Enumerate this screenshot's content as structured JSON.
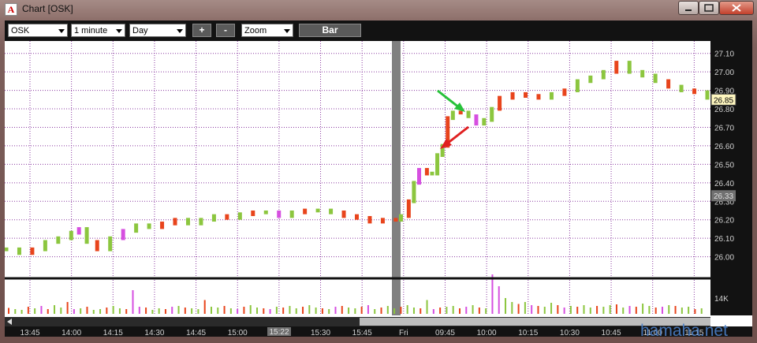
{
  "window": {
    "app_icon_letter": "A",
    "title": "Chart [OSK]"
  },
  "toolbar": {
    "symbol": "OSK",
    "interval": "1 minute",
    "range": "Day",
    "zoom_in_label": "+",
    "zoom_out_label": "-",
    "zoom": "Zoom",
    "chart_style": "Bar"
  },
  "chart_data": {
    "type": "candlestick",
    "symbol": "OSK",
    "y_ticks": [
      "27.10",
      "27.00",
      "26.90",
      "26.80",
      "26.70",
      "26.60",
      "26.50",
      "26.40",
      "26.30",
      "26.20",
      "26.10",
      "26.00"
    ],
    "ylim": [
      25.93,
      27.15
    ],
    "current_price_label": "26.85",
    "cursor_price_label": "26.33",
    "volume_label": "14K",
    "x_ticks": [
      "13:45",
      "14:00",
      "14:15",
      "14:30",
      "14:45",
      "15:00",
      "15:15",
      "15:30",
      "15:45",
      "Fri",
      "09:45",
      "10:00",
      "10:15",
      "10:30",
      "10:45",
      "11:00",
      "11:15"
    ],
    "cursor_time_label": "15:22",
    "price_series": [
      [
        0,
        26.04
      ],
      [
        5,
        26.02
      ],
      [
        10,
        26.04
      ],
      [
        15,
        26.08
      ],
      [
        20,
        26.1
      ],
      [
        25,
        26.13
      ],
      [
        28,
        26.15
      ],
      [
        31,
        26.08
      ],
      [
        35,
        26.04
      ],
      [
        40,
        26.1
      ],
      [
        45,
        26.14
      ],
      [
        50,
        26.17
      ],
      [
        55,
        26.16
      ],
      [
        60,
        26.18
      ],
      [
        65,
        26.2
      ],
      [
        70,
        26.18
      ],
      [
        75,
        26.2
      ],
      [
        80,
        26.22
      ],
      [
        85,
        26.21
      ],
      [
        90,
        26.23
      ],
      [
        95,
        26.24
      ],
      [
        100,
        26.24
      ],
      [
        105,
        26.22
      ],
      [
        110,
        26.24
      ],
      [
        115,
        26.25
      ],
      [
        120,
        26.25
      ],
      [
        125,
        26.24
      ],
      [
        130,
        26.22
      ],
      [
        135,
        26.21
      ],
      [
        140,
        26.19
      ],
      [
        145,
        26.2
      ],
      [
        150,
        26.2
      ],
      [
        152,
        26.22
      ],
      [
        155,
        26.3
      ],
      [
        157,
        26.4
      ],
      [
        159,
        26.47
      ],
      [
        162,
        26.45
      ],
      [
        164,
        26.45
      ],
      [
        166,
        26.55
      ],
      [
        168,
        26.6
      ],
      [
        170,
        26.75
      ],
      [
        172,
        26.78
      ],
      [
        175,
        26.78
      ],
      [
        178,
        26.76
      ],
      [
        181,
        26.72
      ],
      [
        184,
        26.74
      ],
      [
        187,
        26.8
      ],
      [
        190,
        26.86
      ],
      [
        195,
        26.88
      ],
      [
        200,
        26.87
      ],
      [
        205,
        26.86
      ],
      [
        210,
        26.88
      ],
      [
        215,
        26.9
      ],
      [
        220,
        26.95
      ],
      [
        225,
        26.97
      ],
      [
        230,
        27.0
      ],
      [
        235,
        27.05
      ],
      [
        240,
        27.0
      ],
      [
        245,
        26.98
      ],
      [
        250,
        26.95
      ],
      [
        255,
        26.92
      ],
      [
        260,
        26.9
      ],
      [
        265,
        26.89
      ],
      [
        270,
        26.86
      ]
    ],
    "red_candle_indices": [
      2,
      8,
      13,
      14,
      18,
      20,
      24,
      27,
      28,
      29,
      30,
      31,
      33,
      36,
      40,
      42,
      47,
      48,
      49,
      50,
      52,
      56,
      60,
      62
    ],
    "pink_candle_indices": [
      6,
      10,
      22,
      35,
      44
    ],
    "volume_values": [
      0.15,
      0.12,
      0.1,
      0.18,
      0.14,
      0.2,
      0.12,
      0.22,
      0.16,
      0.3,
      0.12,
      0.14,
      0.18,
      0.1,
      0.12,
      0.16,
      0.2,
      0.14,
      0.12,
      0.6,
      0.18,
      0.16,
      0.1,
      0.14,
      0.12,
      0.18,
      0.2,
      0.16,
      0.14,
      0.12,
      0.35,
      0.18,
      0.16,
      0.2,
      0.14,
      0.12,
      0.18,
      0.22,
      0.16,
      0.14,
      0.12,
      0.18,
      0.16,
      0.2,
      0.14,
      0.18,
      0.22,
      0.16,
      0.14,
      0.12,
      0.18,
      0.2,
      0.16,
      0.14,
      0.18,
      0.22,
      0.12,
      0.16,
      0.2,
      0.14,
      0.18,
      0.22,
      0.16,
      0.14,
      0.35,
      0.12,
      0.16,
      0.18,
      0.2,
      0.14,
      0.18,
      0.22,
      0.16,
      0.14,
      1.0,
      0.7,
      0.4,
      0.3,
      0.25,
      0.3,
      0.22,
      0.2,
      0.18,
      0.28,
      0.22,
      0.16,
      0.2,
      0.18,
      0.22,
      0.16,
      0.2,
      0.18,
      0.22,
      0.24,
      0.16,
      0.2,
      0.18,
      0.26,
      0.2,
      0.16,
      0.18,
      0.22,
      0.2,
      0.16,
      0.18,
      0.12,
      0.14
    ]
  },
  "colors": {
    "up": "#8cc63f",
    "down": "#e8441c",
    "pink": "#d64fe0",
    "grid": "#8a3aa0",
    "separator": "#808080",
    "arrow_green": "#27c23a",
    "arrow_red": "#e02020"
  },
  "watermark": "hamaha.net"
}
